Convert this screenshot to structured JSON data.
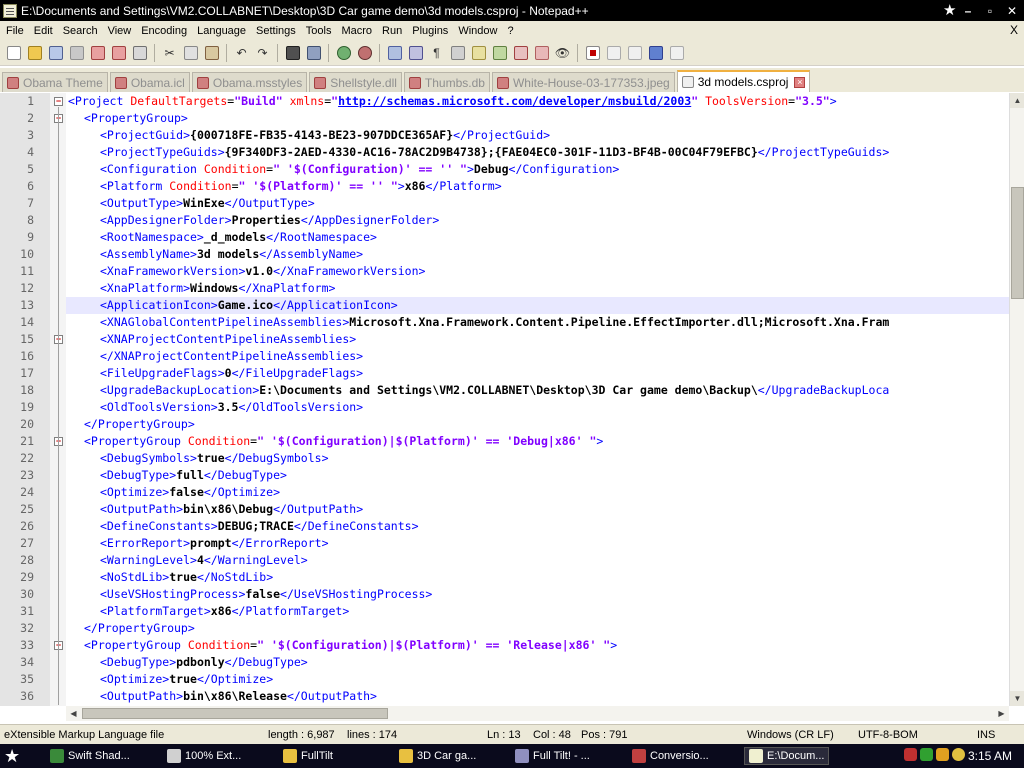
{
  "window": {
    "title": "E:\\Documents and Settings\\VM2.COLLABNET\\Desktop\\3D Car game demo\\3d models.csproj - Notepad++",
    "controls": [
      "–",
      "▫",
      "✕"
    ]
  },
  "menu": {
    "items": [
      "File",
      "Edit",
      "Search",
      "View",
      "Encoding",
      "Language",
      "Settings",
      "Tools",
      "Macro",
      "Run",
      "Plugins",
      "Window",
      "?"
    ],
    "close": "X"
  },
  "tabs": [
    {
      "label": "Obama Theme",
      "active": false
    },
    {
      "label": "Obama.icl",
      "active": false
    },
    {
      "label": "Obama.msstyles",
      "active": false
    },
    {
      "label": "Shellstyle.dll",
      "active": false
    },
    {
      "label": "Thumbs.db",
      "active": false
    },
    {
      "label": "White-House-03-177353.jpeg",
      "active": false
    },
    {
      "label": "3d models.csproj",
      "active": true
    }
  ],
  "editor": {
    "current_line": 13,
    "lines": [
      {
        "n": 1,
        "fold": "minus",
        "indent": 0,
        "tokens": [
          [
            "tag",
            "<Project "
          ],
          [
            "attr",
            "DefaultTargets"
          ],
          [
            "plain",
            "="
          ],
          [
            "val",
            "\"Build\""
          ],
          [
            "plain",
            " "
          ],
          [
            "attr",
            "xmlns"
          ],
          [
            "plain",
            "="
          ],
          [
            "val",
            "\""
          ],
          [
            "link",
            "http://schemas.microsoft.com/developer/msbuild/2003"
          ],
          [
            "val",
            "\""
          ],
          [
            "plain",
            " "
          ],
          [
            "attr",
            "ToolsVersion"
          ],
          [
            "plain",
            "="
          ],
          [
            "val",
            "\"3.5\""
          ],
          [
            "tag",
            ">"
          ]
        ]
      },
      {
        "n": 2,
        "fold": "minus",
        "indent": 1,
        "tokens": [
          [
            "tag",
            "<PropertyGroup>"
          ]
        ]
      },
      {
        "n": 3,
        "indent": 2,
        "tokens": [
          [
            "tag",
            "<ProjectGuid>"
          ],
          [
            "text",
            "{000718FE-FB35-4143-BE23-907DDCE365AF}"
          ],
          [
            "tag",
            "</ProjectGuid>"
          ]
        ]
      },
      {
        "n": 4,
        "indent": 2,
        "tokens": [
          [
            "tag",
            "<ProjectTypeGuids>"
          ],
          [
            "text",
            "{9F340DF3-2AED-4330-AC16-78AC2D9B4738};{FAE04EC0-301F-11D3-BF4B-00C04F79EFBC}"
          ],
          [
            "tag",
            "</ProjectTypeGuids>"
          ]
        ]
      },
      {
        "n": 5,
        "indent": 2,
        "tokens": [
          [
            "tag",
            "<Configuration "
          ],
          [
            "attr",
            "Condition"
          ],
          [
            "plain",
            "="
          ],
          [
            "val",
            "\" '$(Configuration)' == '' \""
          ],
          [
            "tag",
            ">"
          ],
          [
            "text",
            "Debug"
          ],
          [
            "tag",
            "</Configuration>"
          ]
        ]
      },
      {
        "n": 6,
        "indent": 2,
        "tokens": [
          [
            "tag",
            "<Platform "
          ],
          [
            "attr",
            "Condition"
          ],
          [
            "plain",
            "="
          ],
          [
            "val",
            "\" '$(Platform)' == '' \""
          ],
          [
            "tag",
            ">"
          ],
          [
            "text",
            "x86"
          ],
          [
            "tag",
            "</Platform>"
          ]
        ]
      },
      {
        "n": 7,
        "indent": 2,
        "tokens": [
          [
            "tag",
            "<OutputType>"
          ],
          [
            "text",
            "WinExe"
          ],
          [
            "tag",
            "</OutputType>"
          ]
        ]
      },
      {
        "n": 8,
        "indent": 2,
        "tokens": [
          [
            "tag",
            "<AppDesignerFolder>"
          ],
          [
            "text",
            "Properties"
          ],
          [
            "tag",
            "</AppDesignerFolder>"
          ]
        ]
      },
      {
        "n": 9,
        "indent": 2,
        "tokens": [
          [
            "tag",
            "<RootNamespace>"
          ],
          [
            "text",
            "_d_models"
          ],
          [
            "tag",
            "</RootNamespace>"
          ]
        ]
      },
      {
        "n": 10,
        "indent": 2,
        "tokens": [
          [
            "tag",
            "<AssemblyName>"
          ],
          [
            "text",
            "3d models"
          ],
          [
            "tag",
            "</AssemblyName>"
          ]
        ]
      },
      {
        "n": 11,
        "indent": 2,
        "tokens": [
          [
            "tag",
            "<XnaFrameworkVersion>"
          ],
          [
            "text",
            "v1.0"
          ],
          [
            "tag",
            "</XnaFrameworkVersion>"
          ]
        ]
      },
      {
        "n": 12,
        "indent": 2,
        "tokens": [
          [
            "tag",
            "<XnaPlatform>"
          ],
          [
            "text",
            "Windows"
          ],
          [
            "tag",
            "</XnaPlatform>"
          ]
        ]
      },
      {
        "n": 13,
        "indent": 2,
        "tokens": [
          [
            "tag",
            "<ApplicationIcon>"
          ],
          [
            "text",
            "Game.ico"
          ],
          [
            "tag",
            "</ApplicationIcon>"
          ]
        ]
      },
      {
        "n": 14,
        "indent": 2,
        "tokens": [
          [
            "tag",
            "<XNAGlobalContentPipelineAssemblies>"
          ],
          [
            "text",
            "Microsoft.Xna.Framework.Content.Pipeline.EffectImporter.dll;Microsoft.Xna.Fram"
          ]
        ]
      },
      {
        "n": 15,
        "fold": "minus",
        "indent": 2,
        "tokens": [
          [
            "tag",
            "<XNAProjectContentPipelineAssemblies>"
          ]
        ]
      },
      {
        "n": 16,
        "indent": 2,
        "tokens": [
          [
            "tag",
            "</XNAProjectContentPipelineAssemblies>"
          ]
        ]
      },
      {
        "n": 17,
        "indent": 2,
        "tokens": [
          [
            "tag",
            "<FileUpgradeFlags>"
          ],
          [
            "text",
            "0"
          ],
          [
            "tag",
            "</FileUpgradeFlags>"
          ]
        ]
      },
      {
        "n": 18,
        "indent": 2,
        "tokens": [
          [
            "tag",
            "<UpgradeBackupLocation>"
          ],
          [
            "text",
            "E:\\Documents and Settings\\VM2.COLLABNET\\Desktop\\3D Car game demo\\Backup\\"
          ],
          [
            "tag",
            "</UpgradeBackupLoca"
          ]
        ]
      },
      {
        "n": 19,
        "indent": 2,
        "tokens": [
          [
            "tag",
            "<OldToolsVersion>"
          ],
          [
            "text",
            "3.5"
          ],
          [
            "tag",
            "</OldToolsVersion>"
          ]
        ]
      },
      {
        "n": 20,
        "indent": 1,
        "tokens": [
          [
            "tag",
            "</PropertyGroup>"
          ]
        ]
      },
      {
        "n": 21,
        "fold": "minus",
        "indent": 1,
        "tokens": [
          [
            "tag",
            "<PropertyGroup "
          ],
          [
            "attr",
            "Condition"
          ],
          [
            "plain",
            "="
          ],
          [
            "val",
            "\" '$(Configuration)|$(Platform)' == 'Debug|x86' \""
          ],
          [
            "tag",
            ">"
          ]
        ]
      },
      {
        "n": 22,
        "indent": 2,
        "tokens": [
          [
            "tag",
            "<DebugSymbols>"
          ],
          [
            "text",
            "true"
          ],
          [
            "tag",
            "</DebugSymbols>"
          ]
        ]
      },
      {
        "n": 23,
        "indent": 2,
        "tokens": [
          [
            "tag",
            "<DebugType>"
          ],
          [
            "text",
            "full"
          ],
          [
            "tag",
            "</DebugType>"
          ]
        ]
      },
      {
        "n": 24,
        "indent": 2,
        "tokens": [
          [
            "tag",
            "<Optimize>"
          ],
          [
            "text",
            "false"
          ],
          [
            "tag",
            "</Optimize>"
          ]
        ]
      },
      {
        "n": 25,
        "indent": 2,
        "tokens": [
          [
            "tag",
            "<OutputPath>"
          ],
          [
            "text",
            "bin\\x86\\Debug"
          ],
          [
            "tag",
            "</OutputPath>"
          ]
        ]
      },
      {
        "n": 26,
        "indent": 2,
        "tokens": [
          [
            "tag",
            "<DefineConstants>"
          ],
          [
            "text",
            "DEBUG;TRACE"
          ],
          [
            "tag",
            "</DefineConstants>"
          ]
        ]
      },
      {
        "n": 27,
        "indent": 2,
        "tokens": [
          [
            "tag",
            "<ErrorReport>"
          ],
          [
            "text",
            "prompt"
          ],
          [
            "tag",
            "</ErrorReport>"
          ]
        ]
      },
      {
        "n": 28,
        "indent": 2,
        "tokens": [
          [
            "tag",
            "<WarningLevel>"
          ],
          [
            "text",
            "4"
          ],
          [
            "tag",
            "</WarningLevel>"
          ]
        ]
      },
      {
        "n": 29,
        "indent": 2,
        "tokens": [
          [
            "tag",
            "<NoStdLib>"
          ],
          [
            "text",
            "true"
          ],
          [
            "tag",
            "</NoStdLib>"
          ]
        ]
      },
      {
        "n": 30,
        "indent": 2,
        "tokens": [
          [
            "tag",
            "<UseVSHostingProcess>"
          ],
          [
            "text",
            "false"
          ],
          [
            "tag",
            "</UseVSHostingProcess>"
          ]
        ]
      },
      {
        "n": 31,
        "indent": 2,
        "tokens": [
          [
            "tag",
            "<PlatformTarget>"
          ],
          [
            "text",
            "x86"
          ],
          [
            "tag",
            "</PlatformTarget>"
          ]
        ]
      },
      {
        "n": 32,
        "indent": 1,
        "tokens": [
          [
            "tag",
            "</PropertyGroup>"
          ]
        ]
      },
      {
        "n": 33,
        "fold": "minus",
        "indent": 1,
        "tokens": [
          [
            "tag",
            "<PropertyGroup "
          ],
          [
            "attr",
            "Condition"
          ],
          [
            "plain",
            "="
          ],
          [
            "val",
            "\" '$(Configuration)|$(Platform)' == 'Release|x86' \""
          ],
          [
            "tag",
            ">"
          ]
        ]
      },
      {
        "n": 34,
        "indent": 2,
        "tokens": [
          [
            "tag",
            "<DebugType>"
          ],
          [
            "text",
            "pdbonly"
          ],
          [
            "tag",
            "</DebugType>"
          ]
        ]
      },
      {
        "n": 35,
        "indent": 2,
        "tokens": [
          [
            "tag",
            "<Optimize>"
          ],
          [
            "text",
            "true"
          ],
          [
            "tag",
            "</Optimize>"
          ]
        ]
      },
      {
        "n": 36,
        "indent": 2,
        "tokens": [
          [
            "tag",
            "<OutputPath>"
          ],
          [
            "text",
            "bin\\x86\\Release"
          ],
          [
            "tag",
            "</OutputPath>"
          ]
        ]
      }
    ]
  },
  "status": {
    "filetype": "eXtensible Markup Language file",
    "length": "length : 6,987",
    "lines": "lines : 174",
    "ln": "Ln : 13",
    "col": "Col : 48",
    "pos": "Pos : 791",
    "eol": "Windows (CR LF)",
    "encoding": "UTF-8-BOM",
    "mode": "INS"
  },
  "taskbar": {
    "items": [
      {
        "label": "Swift Shad...",
        "color": "#3a8a3a"
      },
      {
        "label": "100% Ext...",
        "color": "#d0d0d0"
      },
      {
        "label": "FullTilt",
        "color": "#e8c040"
      },
      {
        "label": "3D Car ga...",
        "color": "#e8c040"
      },
      {
        "label": "Full Tilt! - ...",
        "color": "#9090c0"
      },
      {
        "label": "Conversio...",
        "color": "#c04040"
      },
      {
        "label": "E:\\Docum...",
        "color": "#f0f0d0",
        "active": true
      }
    ],
    "clock": "3:15 AM"
  }
}
